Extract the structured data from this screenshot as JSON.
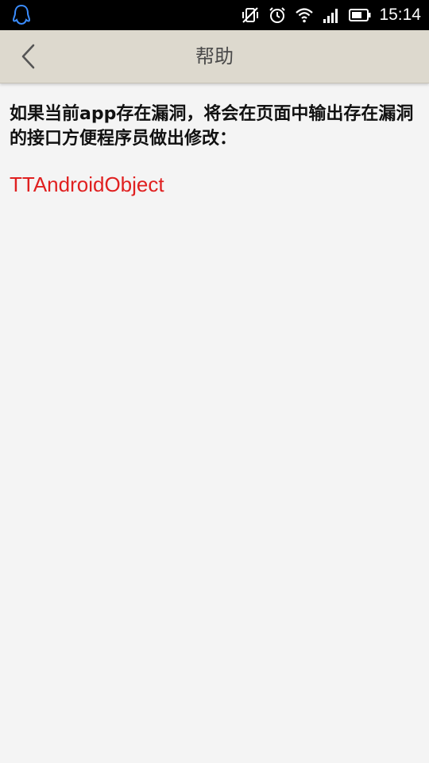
{
  "status_bar": {
    "left_icon": "qq-penguin-icon",
    "icons": [
      "vibrate-off-icon",
      "alarm-icon",
      "wifi-icon",
      "signal-icon",
      "battery-icon"
    ],
    "time": "15:14"
  },
  "header": {
    "back_icon": "chevron-left-icon",
    "title": "帮助"
  },
  "content": {
    "help_text": "如果当前app存在漏洞，将会在页面中输出存在漏洞的接口方便程序员做出修改：",
    "vulnerable_interfaces": [
      "TTAndroidObject"
    ]
  },
  "colors": {
    "header_background": "#ddd9ce",
    "page_background": "#f4f4f4",
    "highlight_text": "#e02020"
  }
}
